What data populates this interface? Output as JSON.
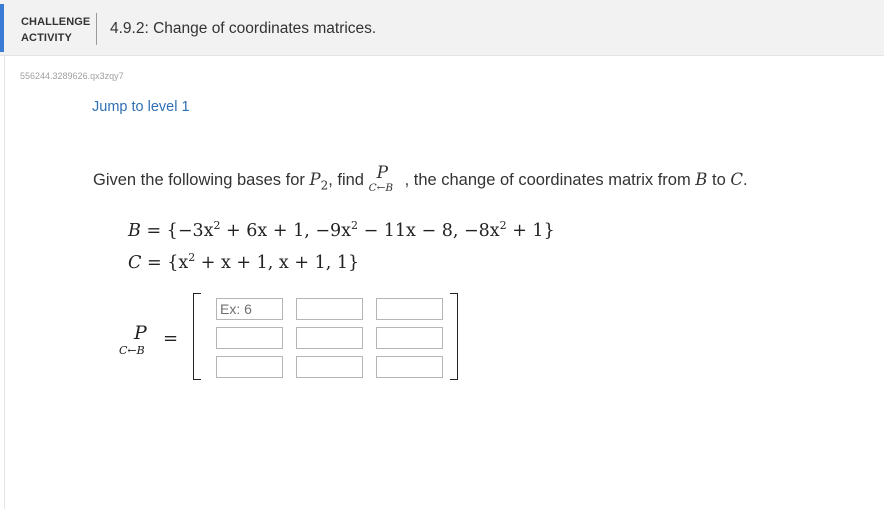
{
  "header": {
    "badge_line1": "CHALLENGE",
    "badge_line2": "ACTIVITY",
    "title": "4.9.2: Change of coordinates matrices."
  },
  "question_id": "556244.3289626.qx3zqy7",
  "jump_link": "Jump to level 1",
  "prompt": {
    "part1": "Given the following bases for ",
    "space": "P",
    "space_sub": "2",
    "part2": ", find ",
    "matrix_symbol": "P",
    "matrix_sub": "C←B",
    "part3": ", the change of coordinates matrix from ",
    "basis_from": "B",
    "part4": " to ",
    "basis_to": "C",
    "part5": "."
  },
  "equations": {
    "B_lhs": "B",
    "B_rhs_parts": [
      "= {−3x",
      "2",
      " + 6x + 1, −9x",
      "2",
      " − 11x − 8, −8x",
      "2",
      " + 1}"
    ],
    "C_lhs": "C",
    "C_rhs_parts": [
      "= {x",
      "2",
      " + x + 1, x + 1, 1}"
    ]
  },
  "matrix_label": {
    "symbol": "P",
    "sub": "C←B",
    "equals": "="
  },
  "matrix_inputs": {
    "rows": [
      [
        {
          "value": "",
          "placeholder": "Ex: 6"
        },
        {
          "value": "",
          "placeholder": ""
        },
        {
          "value": "",
          "placeholder": ""
        }
      ],
      [
        {
          "value": "",
          "placeholder": ""
        },
        {
          "value": "",
          "placeholder": ""
        },
        {
          "value": "",
          "placeholder": ""
        }
      ],
      [
        {
          "value": "",
          "placeholder": ""
        },
        {
          "value": "",
          "placeholder": ""
        },
        {
          "value": "",
          "placeholder": ""
        }
      ]
    ]
  },
  "colors": {
    "accent": "#3a7bd5",
    "link": "#2f6fb5",
    "header_bg": "#f2f2f2"
  }
}
